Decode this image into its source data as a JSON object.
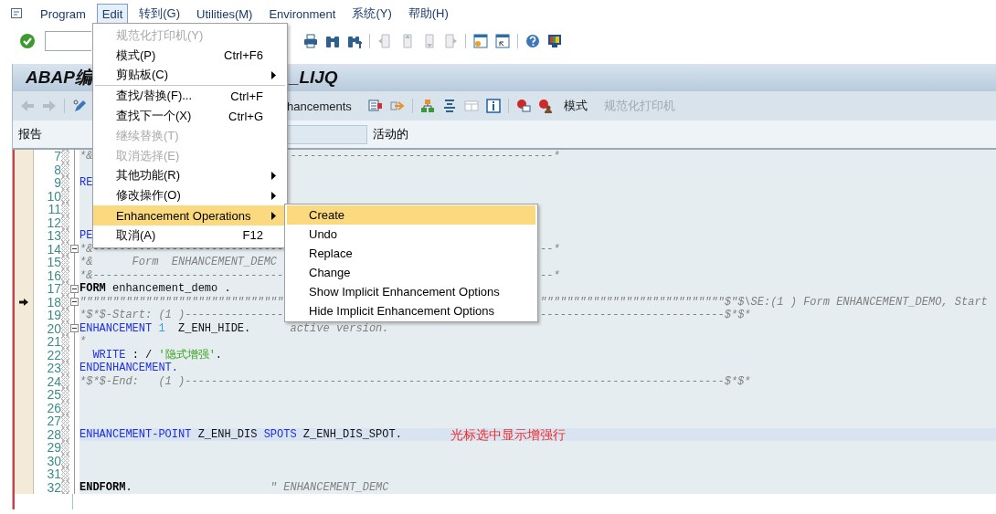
{
  "menu_bar": [
    {
      "label": "Program",
      "selected": false
    },
    {
      "label": "Edit",
      "selected": true
    },
    {
      "label": "转到(G)",
      "selected": false
    },
    {
      "label": "Utilities(M)",
      "selected": false
    },
    {
      "label": "Environment",
      "selected": false
    },
    {
      "label": "系统(Y)",
      "selected": false
    },
    {
      "label": "帮助(H)",
      "selected": false
    }
  ],
  "standard_toolbar": [
    {
      "kind": "printer",
      "disabled": false
    },
    {
      "kind": "binoculars",
      "disabled": false
    },
    {
      "kind": "binoculars-plus",
      "disabled": false
    },
    {
      "kind": "sep"
    },
    {
      "kind": "page-first",
      "disabled": true
    },
    {
      "kind": "page-prev",
      "disabled": true
    },
    {
      "kind": "page-next",
      "disabled": true
    },
    {
      "kind": "page-last",
      "disabled": true
    },
    {
      "kind": "sep"
    },
    {
      "kind": "window-new",
      "disabled": false
    },
    {
      "kind": "window-link",
      "disabled": false
    },
    {
      "kind": "sep"
    },
    {
      "kind": "help",
      "disabled": false
    },
    {
      "kind": "monitor",
      "disabled": false
    }
  ],
  "title": {
    "left": "ABAP编",
    "right": "_LIJQ"
  },
  "app_toolbar": {
    "left": [
      {
        "kind": "arrow-left",
        "disabled": true
      },
      {
        "kind": "arrow-right",
        "disabled": true
      },
      {
        "kind": "sep"
      },
      {
        "kind": "pen",
        "disabled": false
      }
    ],
    "button_label": "hancements",
    "right": [
      {
        "kind": "stamp",
        "disabled": false
      },
      {
        "kind": "arrow-box",
        "disabled": false
      },
      {
        "kind": "sep"
      },
      {
        "kind": "hierarchy",
        "disabled": false
      },
      {
        "kind": "lines",
        "disabled": false
      },
      {
        "kind": "table",
        "disabled": true
      },
      {
        "kind": "info",
        "disabled": false
      },
      {
        "kind": "sep"
      },
      {
        "kind": "stop-screen",
        "disabled": false
      },
      {
        "kind": "stop-person",
        "disabled": false
      }
    ],
    "text_buttons": [
      {
        "label": "模式",
        "disabled": false
      },
      {
        "label": "规范化打印机",
        "disabled": true
      }
    ]
  },
  "program_row": {
    "label": "报告",
    "status": "活动的"
  },
  "code_lines": [
    {
      "number": "7",
      "fold_toggle": false,
      "current": false,
      "selected": false,
      "parts": [
        {
          "text": "*&",
          "kind": "comment"
        },
        {
          "text": "                              ----------------------------------------*",
          "kind": "comment"
        }
      ]
    },
    {
      "number": "8",
      "fold_toggle": false,
      "current": false,
      "selected": false
    },
    {
      "number": "9",
      "fold_toggle": false,
      "current": false,
      "selected": false,
      "parts": [
        {
          "text": "RE",
          "kind": "keyword"
        }
      ]
    },
    {
      "number": "10",
      "fold_toggle": false,
      "current": false,
      "selected": false
    },
    {
      "number": "11",
      "fold_toggle": false,
      "current": false,
      "selected": false
    },
    {
      "number": "12",
      "fold_toggle": false,
      "current": false,
      "selected": false
    },
    {
      "number": "13",
      "fold_toggle": false,
      "current": false,
      "selected": false,
      "parts": [
        {
          "text": "PE",
          "kind": "keyword"
        }
      ]
    },
    {
      "number": "14",
      "fold_toggle": true,
      "current": false,
      "selected": false,
      "parts": [
        {
          "text": "*&-----------------------------",
          "kind": "comment"
        },
        {
          "text": "                                       --*",
          "kind": "comment"
        }
      ]
    },
    {
      "number": "15",
      "fold_toggle": false,
      "current": false,
      "selected": false,
      "parts": [
        {
          "text": "*&      Form  ENHANCEMENT_DEMC",
          "kind": "comment"
        }
      ]
    },
    {
      "number": "16",
      "fold_toggle": false,
      "current": false,
      "selected": false,
      "parts": [
        {
          "text": "*&-----------------------------",
          "kind": "comment"
        },
        {
          "text": "                                       --*",
          "kind": "comment"
        }
      ]
    },
    {
      "number": "17",
      "fold_toggle": true,
      "current": false,
      "selected": false,
      "parts": [
        {
          "text": "FORM",
          "kind": "bold"
        },
        {
          "text": " enhancement_demo .",
          "kind": "plain"
        }
      ]
    },
    {
      "number": "18",
      "fold_toggle": true,
      "current": true,
      "selected": false,
      "parts": [
        {
          "text": "\"\"\"\"\"\"\"\"\"\"\"\"\"\"\"\"\"\"\"\"\"\"\"\"\"\"\"\"\"\"\"",
          "kind": "comment"
        },
        {
          "text": "                                       \"\"\"\"\"\"\"\"\"\"\"\"\"\"\"\"\"\"\"\"\"\"\"\"\"\"\"\"$\"$\\SE:(1 ) Form ENHANCEMENT_DEMO, Start",
          "kind": "comment"
        }
      ]
    },
    {
      "number": "19",
      "fold_toggle": false,
      "current": false,
      "selected": false,
      "parts": [
        {
          "text": "*$*$-Start: (1 )---------------",
          "kind": "comment"
        },
        {
          "text": "                                       ----------------------------$*$*",
          "kind": "comment"
        }
      ]
    },
    {
      "number": "20",
      "fold_toggle": true,
      "current": false,
      "selected": false,
      "parts": [
        {
          "text": "ENHANCEMENT",
          "kind": "keyword"
        },
        {
          "text": " 1",
          "kind": "number"
        },
        {
          "text": "  Z_ENH_HIDE.",
          "kind": "plain"
        },
        {
          "text": "      active version.",
          "kind": "comment"
        }
      ]
    },
    {
      "number": "21",
      "fold_toggle": false,
      "current": false,
      "selected": false,
      "parts": [
        {
          "text": "*",
          "kind": "comment"
        }
      ]
    },
    {
      "number": "22",
      "fold_toggle": false,
      "current": false,
      "selected": false,
      "parts": [
        {
          "text": "  WRITE",
          "kind": "keyword"
        },
        {
          "text": " : / ",
          "kind": "plain"
        },
        {
          "text": "'隐式增强'",
          "kind": "string"
        },
        {
          "text": ".",
          "kind": "plain"
        }
      ]
    },
    {
      "number": "23",
      "fold_toggle": false,
      "current": false,
      "selected": false,
      "parts": [
        {
          "text": "ENDENHANCEMENT.",
          "kind": "keyword"
        }
      ]
    },
    {
      "number": "24",
      "fold_toggle": false,
      "current": false,
      "selected": false,
      "parts": [
        {
          "text": "*$*$-End:   (1 )----------------------------------------------------------------------------------$*$*",
          "kind": "comment"
        }
      ]
    },
    {
      "number": "25",
      "fold_toggle": false,
      "current": false,
      "selected": false
    },
    {
      "number": "26",
      "fold_toggle": false,
      "current": false,
      "selected": false
    },
    {
      "number": "27",
      "fold_toggle": false,
      "current": false,
      "selected": false
    },
    {
      "number": "28",
      "fold_toggle": false,
      "current": false,
      "selected": true,
      "parts": [
        {
          "text": "ENHANCEMENT-POINT",
          "kind": "keyword"
        },
        {
          "text": " Z_ENH_DIS ",
          "kind": "plain"
        },
        {
          "text": "SPOTS",
          "kind": "keyword"
        },
        {
          "text": " Z_ENH_DIS_SPOT.",
          "kind": "plain"
        }
      ],
      "note": "光标选中显示增强行"
    },
    {
      "number": "29",
      "fold_toggle": false,
      "current": false,
      "selected": false
    },
    {
      "number": "30",
      "fold_toggle": false,
      "current": false,
      "selected": false
    },
    {
      "number": "31",
      "fold_toggle": false,
      "current": false,
      "selected": false
    },
    {
      "number": "32",
      "fold_toggle": false,
      "current": false,
      "selected": false,
      "parts": [
        {
          "text": "ENDFORM",
          "kind": "bold"
        },
        {
          "text": ".",
          "kind": "plain"
        },
        {
          "text": "                     \" ENHANCEMENT_DEMC",
          "kind": "comment"
        }
      ]
    }
  ],
  "edit_menu": [
    {
      "kind": "item",
      "label": "规范化打印机(Y)",
      "submenu": false,
      "disabled": true,
      "selected": false
    },
    {
      "kind": "item",
      "label": "模式(P)",
      "shortcut": "Ctrl+F6",
      "submenu": false,
      "disabled": false,
      "selected": false
    },
    {
      "kind": "item",
      "label": "剪贴板(C)",
      "submenu": true,
      "disabled": false,
      "selected": false
    },
    {
      "kind": "separator"
    },
    {
      "kind": "item",
      "label": "查找/替换(F)...",
      "shortcut": "Ctrl+F",
      "submenu": false,
      "disabled": false,
      "selected": false
    },
    {
      "kind": "item",
      "label": "查找下一个(X)",
      "shortcut": "Ctrl+G",
      "submenu": false,
      "disabled": false,
      "selected": false
    },
    {
      "kind": "item",
      "label": "继续替换(T)",
      "submenu": false,
      "disabled": true,
      "selected": false
    },
    {
      "kind": "item",
      "label": "取消选择(E)",
      "submenu": false,
      "disabled": true,
      "selected": false
    },
    {
      "kind": "item",
      "label": "其他功能(R)",
      "submenu": true,
      "disabled": false,
      "selected": false
    },
    {
      "kind": "item",
      "label": "修改操作(O)",
      "submenu": true,
      "disabled": false,
      "selected": false
    },
    {
      "kind": "item",
      "label": "Enhancement Operations",
      "submenu": true,
      "disabled": false,
      "selected": true
    },
    {
      "kind": "item",
      "label": "取消(A)",
      "shortcut": "F12",
      "submenu": false,
      "disabled": false,
      "selected": false
    }
  ],
  "enhancement_submenu": [
    {
      "label": "Create",
      "selected": true
    },
    {
      "label": "Undo",
      "selected": false
    },
    {
      "label": "Replace",
      "selected": false
    },
    {
      "label": "Change",
      "selected": false
    },
    {
      "label": "Show Implicit Enhancement Options",
      "selected": false
    },
    {
      "label": "Hide Implicit Enhancement Options",
      "selected": false
    }
  ]
}
